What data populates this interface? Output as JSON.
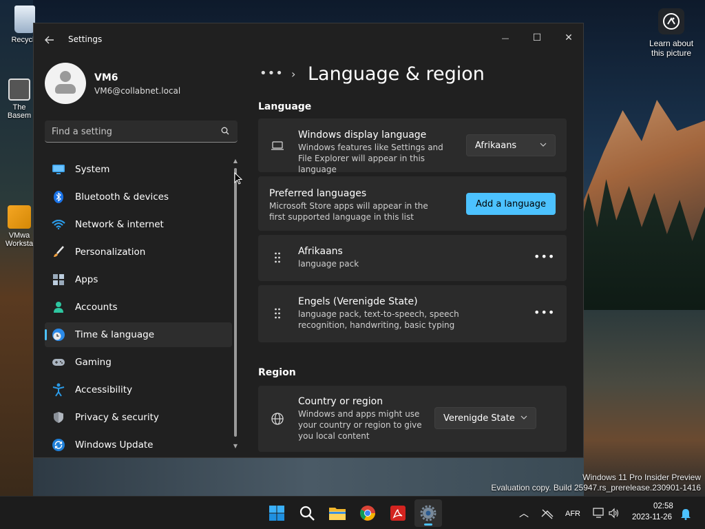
{
  "desktop": {
    "icons": [
      {
        "label": "Recycle"
      },
      {
        "label": "The Basem"
      },
      {
        "label": "VMwa Worksta"
      }
    ],
    "learn_label": "Learn about this picture",
    "watermark": {
      "line1": "Windows 11 Pro Insider Preview",
      "line2": "Evaluation copy. Build 25947.rs_prerelease.230901-1416"
    }
  },
  "window": {
    "title": "Settings",
    "controls": {
      "minimize": "—",
      "maximize": "☐",
      "close": "✕"
    }
  },
  "profile": {
    "name": "VM6",
    "email": "VM6@collabnet.local"
  },
  "search": {
    "placeholder": "Find a setting"
  },
  "nav": {
    "items": [
      {
        "label": "System",
        "icon": "system-icon"
      },
      {
        "label": "Bluetooth & devices",
        "icon": "bluetooth-icon"
      },
      {
        "label": "Network & internet",
        "icon": "wifi-icon"
      },
      {
        "label": "Personalization",
        "icon": "brush-icon"
      },
      {
        "label": "Apps",
        "icon": "apps-icon"
      },
      {
        "label": "Accounts",
        "icon": "person-icon"
      },
      {
        "label": "Time & language",
        "icon": "globe-clock-icon",
        "active": true
      },
      {
        "label": "Gaming",
        "icon": "gamepad-icon"
      },
      {
        "label": "Accessibility",
        "icon": "accessibility-icon"
      },
      {
        "label": "Privacy & security",
        "icon": "shield-icon"
      },
      {
        "label": "Windows Update",
        "icon": "update-icon"
      }
    ]
  },
  "breadcrumb": {
    "more": "•••",
    "separator": "›",
    "title": "Language & region"
  },
  "language": {
    "section_title": "Language",
    "display": {
      "title": "Windows display language",
      "subtitle": "Windows features like Settings and File Explorer will appear in this language",
      "value": "Afrikaans"
    },
    "preferred": {
      "title": "Preferred languages",
      "subtitle": "Microsoft Store apps will appear in the first supported language in this list",
      "button": "Add a language"
    },
    "list": [
      {
        "name": "Afrikaans",
        "features": "language pack"
      },
      {
        "name": "Engels (Verenigde State)",
        "features": "language pack, text-to-speech, speech recognition, handwriting, basic typing"
      }
    ]
  },
  "region": {
    "section_title": "Region",
    "country": {
      "title": "Country or region",
      "subtitle": "Windows and apps might use your country or region to give you local content",
      "value": "Verenigde State"
    }
  },
  "taskbar": {
    "input_lang": "AFR",
    "time": "02:58",
    "date": "2023-11-26"
  },
  "colors": {
    "accent": "#4cc2ff",
    "window_bg": "#202020",
    "card_bg": "#2b2b2b"
  }
}
